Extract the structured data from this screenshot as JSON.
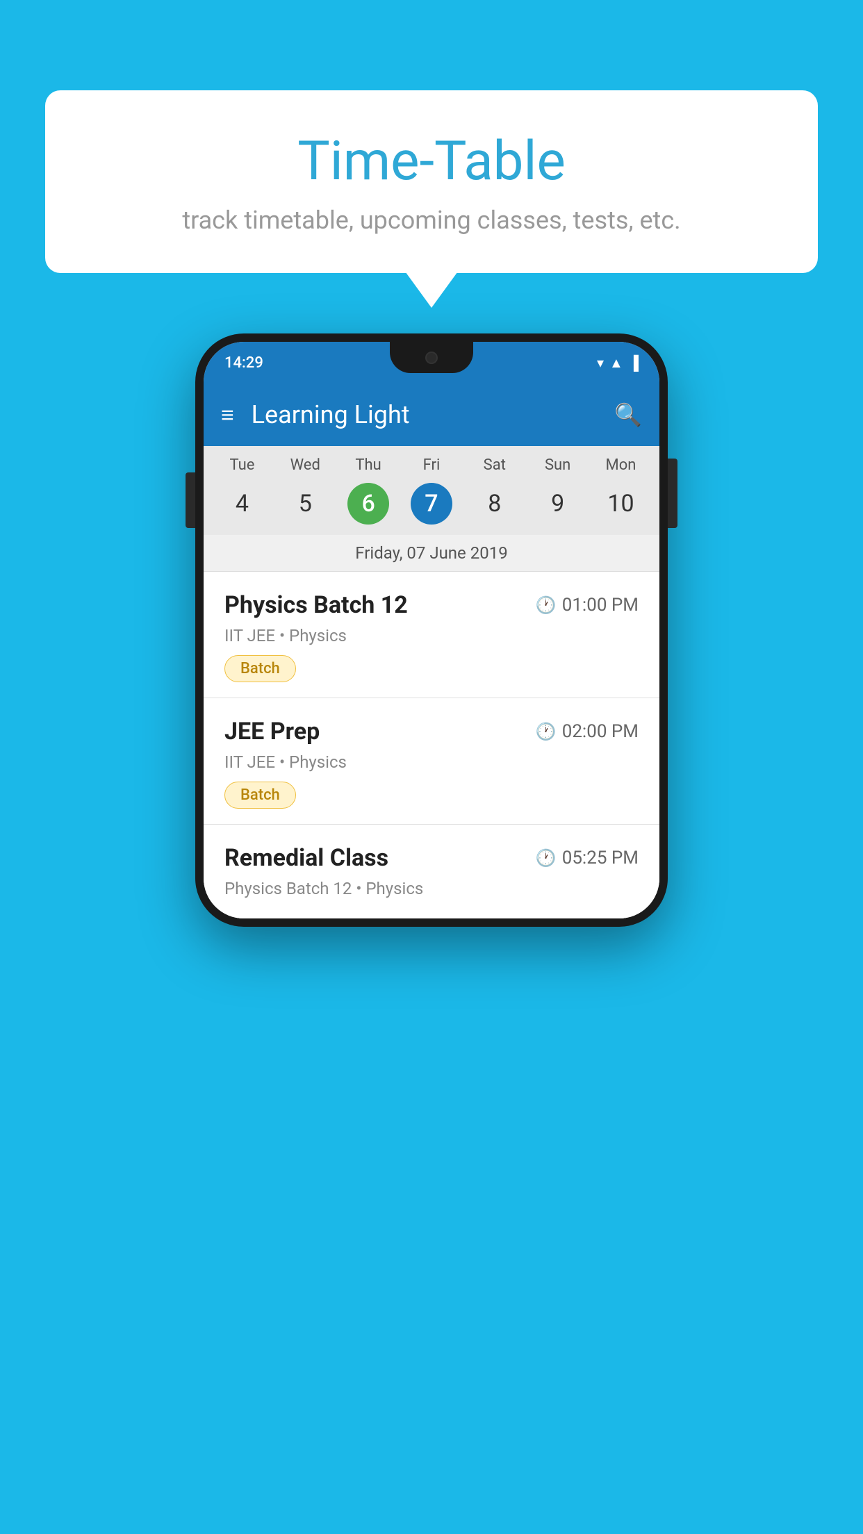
{
  "background_color": "#1BB8E8",
  "bubble": {
    "title": "Time-Table",
    "subtitle": "track timetable, upcoming classes, tests, etc."
  },
  "phone": {
    "status_bar": {
      "time": "14:29"
    },
    "app_bar": {
      "title": "Learning Light"
    },
    "calendar": {
      "days": [
        {
          "name": "Tue",
          "number": "4"
        },
        {
          "name": "Wed",
          "number": "5"
        },
        {
          "name": "Thu",
          "number": "6",
          "state": "today"
        },
        {
          "name": "Fri",
          "number": "7",
          "state": "selected"
        },
        {
          "name": "Sat",
          "number": "8"
        },
        {
          "name": "Sun",
          "number": "9"
        },
        {
          "name": "Mon",
          "number": "10"
        }
      ],
      "selected_date_label": "Friday, 07 June 2019"
    },
    "schedule": [
      {
        "title": "Physics Batch 12",
        "time": "01:00 PM",
        "subtitle": "IIT JEE • Physics",
        "tag": "Batch"
      },
      {
        "title": "JEE Prep",
        "time": "02:00 PM",
        "subtitle": "IIT JEE • Physics",
        "tag": "Batch"
      },
      {
        "title": "Remedial Class",
        "time": "05:25 PM",
        "subtitle": "Physics Batch 12 • Physics",
        "tag": null
      }
    ]
  },
  "icons": {
    "hamburger": "≡",
    "search": "🔍",
    "clock": "🕐"
  }
}
